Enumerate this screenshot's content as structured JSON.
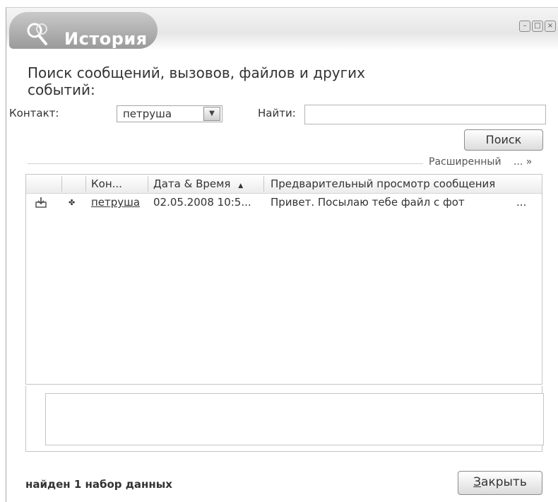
{
  "window": {
    "title": "История",
    "title_icon": "search-people-icon",
    "controls": [
      "minimize-icon",
      "maximize-icon",
      "close-icon"
    ]
  },
  "search": {
    "heading": "Поиск сообщений, вызовов, файлов и других событий:",
    "contact_label": "Контакт:",
    "contact_value": "петруша",
    "find_label": "Найти:",
    "find_value": "",
    "search_button": "Поиск",
    "advanced_label": "Расширенный",
    "advanced_dots": "... »"
  },
  "results": {
    "columns": [
      {
        "label": ""
      },
      {
        "label": ""
      },
      {
        "label": "Кон..."
      },
      {
        "label": "Дата & Время"
      },
      {
        "label": "Предварительный просмотр сообщения"
      }
    ],
    "sort_indicator": "▲",
    "rows": [
      {
        "type_icon": "file-transfer-icon",
        "status_icon": "contact-status-icon",
        "contact": "петруша",
        "datetime": "02.05.2008 10:5...",
        "preview": "Привет. Посылаю тебе файл с фот",
        "more": "..."
      }
    ]
  },
  "splitter_dots": ".....................",
  "status": {
    "text": "найден 1 набор данных"
  },
  "footer": {
    "close_button_first": "З",
    "close_button_rest": "акрыть"
  },
  "colors": {
    "title_blob": "#9a9a9a",
    "border": "#c4c4c4"
  }
}
